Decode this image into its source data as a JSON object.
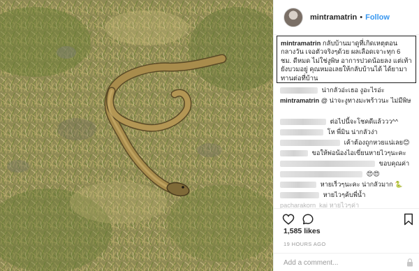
{
  "post": {
    "username": "mintramatrin",
    "separator": "•",
    "follow_label": "Follow"
  },
  "caption": {
    "username": "mintramatrin",
    "text": "กลับบ้านมาดูที่เกิดเหตุตอนกลางวัน เจอตัวจริงๆด้วย ผลเลือดเจาะทุก 6 ชม. ดีหมด ไม่ใช่งูพิษ อาการปวดน้อยลง แต่เท้ายังบวมอยู่ คุณหมอเลยให้กลับบ้านได้ ได้ยามาทานต่อที่บ้าน"
  },
  "comments": [
    {
      "user": "",
      "text": "น่ากลัวอ่ะเธอ งูอะไรอ่ะ"
    },
    {
      "user": "mintramatrin",
      "text": "@                    น่าจะงูทางมะพร้าวนะ ไม่มีพิษ"
    },
    {
      "user": "",
      "text": "ต่อไปนี้จะโชคดีแล้ววว^^"
    },
    {
      "user": "",
      "text": "โห พี่มิน น่ากลัวง่า"
    },
    {
      "user": "",
      "text": "เค้าต้องถูกหวยแน่เลย😊"
    },
    {
      "user": "",
      "text": "ขอให้พ่อน้องไอเขี่ยนหายไวๆนะคะ"
    },
    {
      "user": "",
      "text": "ขอบคุณค่า"
    },
    {
      "user": "",
      "text": "😍😍"
    },
    {
      "user": "",
      "text": "หายเร็วๆนะคะ น่ากลัวมาก 🐍"
    },
    {
      "user": "",
      "text": "หายไวๆค้บพี่น้ำ"
    },
    {
      "user": "pacharakorn_kai",
      "text": "หายไวๆค่า"
    }
  ],
  "icons": [
    "heart-icon",
    "comment-icon",
    "bookmark-icon",
    "lock-icon",
    "avatar"
  ],
  "likes": "1,585 likes",
  "timestamp": "19 HOURS AGO",
  "add_comment": {
    "placeholder": "Add a comment..."
  },
  "colors": {
    "link": "#3897f0",
    "text": "#262626",
    "muted": "#999999",
    "border": "#efefef"
  }
}
